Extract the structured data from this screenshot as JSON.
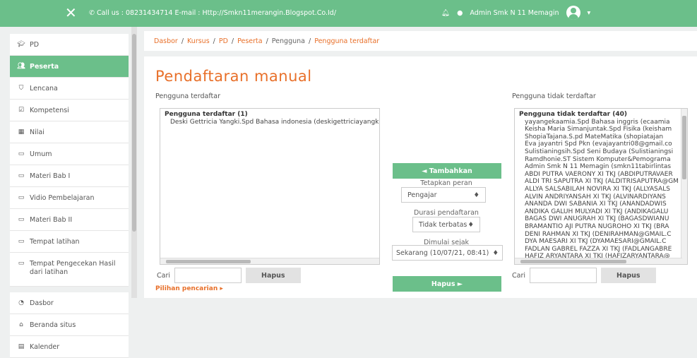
{
  "topbar": {
    "contact": "Call us : 08231434714  E-mail : Http://Smkn11merangin.Blogspot.Co.Id/",
    "user_name": "Admin Smk N 11 Memagin"
  },
  "sidebar": {
    "items": [
      {
        "label": "PD",
        "icon": "graduation-cap-icon"
      },
      {
        "label": "Peserta",
        "icon": "users-icon"
      },
      {
        "label": "Lencana",
        "icon": "shield-icon"
      },
      {
        "label": "Kompetensi",
        "icon": "check-square-icon"
      },
      {
        "label": "Nilai",
        "icon": "table-icon"
      },
      {
        "label": "Umum",
        "icon": "folder-icon"
      },
      {
        "label": "Materi Bab I",
        "icon": "folder-icon"
      },
      {
        "label": "Vidio Pembelajaran",
        "icon": "folder-icon"
      },
      {
        "label": "Materi Bab II",
        "icon": "folder-icon"
      },
      {
        "label": "Tempat latihan",
        "icon": "folder-icon"
      },
      {
        "label": "Tempat Pengecekan Hasil dari latihan",
        "icon": "folder-icon"
      }
    ],
    "items2": [
      {
        "label": "Dasbor",
        "icon": "dashboard-icon"
      },
      {
        "label": "Beranda situs",
        "icon": "home-icon"
      },
      {
        "label": "Kalender",
        "icon": "calendar-icon"
      }
    ]
  },
  "breadcrumb": [
    "Dasbor",
    "Kursus",
    "PD",
    "Peserta",
    "Pengguna",
    "Pengguna terdaftar"
  ],
  "title": "Pendaftaran manual",
  "enrolled": {
    "label": "Pengguna terdaftar",
    "group": "Pengguna terdaftar (1)",
    "options": [
      "Deski Gettricia Yangki.Spd Bahasa indonesia (deskigettriciayangki"
    ]
  },
  "not_enrolled": {
    "label": "Pengguna tidak terdaftar",
    "group": "Pengguna tidak terdaftar (40)",
    "options": [
      "yayangekaamia.Spd Bahasa inggris (ecaamia",
      "Keisha Maria Simanjuntak.Spd Fisika (keisham",
      "ShopiaTajana.S.pd MateMatika (shopiatajan",
      "Eva jayantri Spd Pkn (evajayantri08@gmail.co",
      "Sulistianingsih.Spd Seni Budaya (Sulistianingsi",
      "Ramdhonie.ST Sistem Komputer&Pemograma",
      "Admin Smk N 11 Memagin (smkn11tabirlintas",
      "ABDI PUTRA VAERONY XI TKJ (ABDIPUTRAVAER",
      "ALDI TRI SAPUTRA XI TKJ (ALDITRISAPUTRA@GM",
      "ALLYA SALSABILAH NOVIRA XI TKJ (ALLYASALS",
      "ALVIN ANDRIYANSAH XI TKJ (ALVINARDIYANS",
      "ANANDA DWI SABANIA XI TKJ (ANANDADWIS",
      "ANDIKA GALUH MULYADI XI TKJ (ANDIKAGALU",
      "BAGAS DWI ANUGRAH XI TKJ (BAGASDWIANU",
      "BRAMANTIO AJI PUTRA NUGROHO XI TKJ (BRA",
      "DENI RAHMAN XI TKJ (DENIRAHMAN@GMAIL.C",
      "DYA MAESARI XI TKJ (DYAMAESARI@GMAIL.C",
      "FADLAN GABREL FAZZA XI TKJ (FADLANGABRE",
      "HAFIZ ARYANTARA XI TKJ (HAFIZARYANTARA@"
    ]
  },
  "controls": {
    "add_button": "◄ Tambahkan",
    "role_label": "Tetapkan peran",
    "role_value": "Pengajar",
    "duration_label": "Durasi pendaftaran",
    "duration_value": "Tidak terbatas",
    "start_label": "Dimulai sejak",
    "start_value": "Sekarang (10/07/21, 08:41)",
    "remove_button": "Hapus ►"
  },
  "search": {
    "label": "Cari",
    "clear_label": "Hapus",
    "options_link": "Pilihan pencarian"
  }
}
